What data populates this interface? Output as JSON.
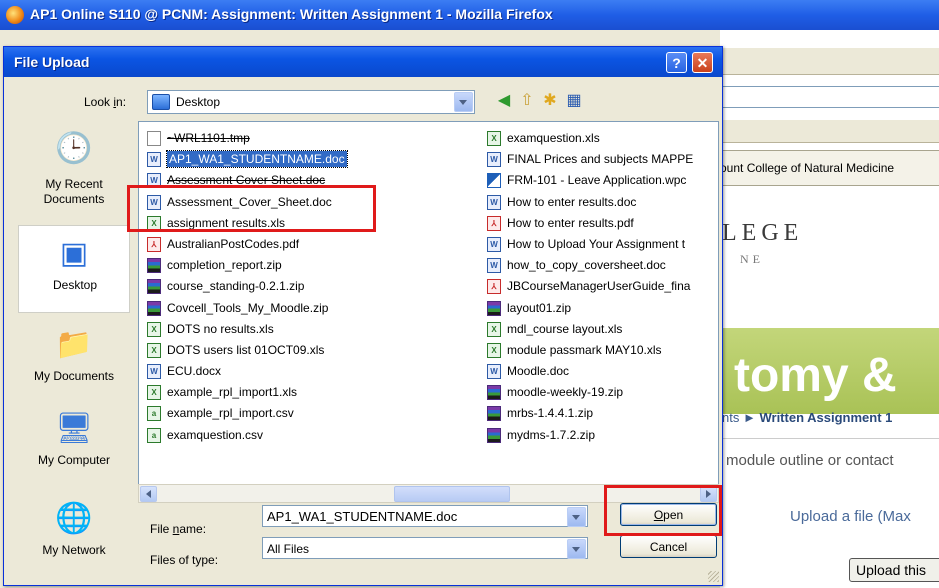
{
  "browser": {
    "title": "AP1 Online S110 @ PCNM: Assignment: Written Assignment 1 - Mozilla Firefox"
  },
  "background_page": {
    "tab_text": "ount College of Natural Medicine",
    "college_heading": "LEGE",
    "college_sub": "NE",
    "banner_text": "tomy &",
    "breadcrumb_prefix": "nts",
    "breadcrumb_sep": "►",
    "breadcrumb_current": "Written Assignment 1",
    "note": "module outline or contact",
    "upload_label": "Upload a file (Max",
    "upload_button": "Upload this"
  },
  "dialog": {
    "title": "File Upload",
    "help_label": "?",
    "close_label": "✕",
    "look_in_label": "Look in:",
    "look_in_value": "Desktop",
    "places": [
      {
        "label": "My Recent Documents",
        "icon": "recent-documents-icon"
      },
      {
        "label": "Desktop",
        "icon": "desktop-icon"
      },
      {
        "label": "My Documents",
        "icon": "my-documents-icon"
      },
      {
        "label": "My Computer",
        "icon": "my-computer-icon"
      },
      {
        "label": "My Network",
        "icon": "my-network-icon"
      }
    ],
    "files_col1": [
      {
        "name": "~WRL1101.tmp",
        "type": "tmp"
      },
      {
        "name": "AP1_WA1_STUDENTNAME.doc",
        "type": "doc"
      },
      {
        "name": "Assessment Cover Sheet.doc",
        "type": "doc"
      },
      {
        "name": "Assessment_Cover_Sheet.doc",
        "type": "doc"
      },
      {
        "name": "assignment results.xls",
        "type": "xls"
      },
      {
        "name": "AustralianPostCodes.pdf",
        "type": "pdf"
      },
      {
        "name": "completion_report.zip",
        "type": "zip"
      },
      {
        "name": "course_standing-0.2.1.zip",
        "type": "zip"
      },
      {
        "name": "Covcell_Tools_My_Moodle.zip",
        "type": "zip"
      },
      {
        "name": "DOTS no results.xls",
        "type": "xls"
      },
      {
        "name": "DOTS users list 01OCT09.xls",
        "type": "xls"
      },
      {
        "name": "ECU.docx",
        "type": "doc"
      },
      {
        "name": "example_rpl_import1.xls",
        "type": "xls"
      },
      {
        "name": "example_rpl_import.csv",
        "type": "csv"
      },
      {
        "name": "examquestion.csv",
        "type": "csv"
      }
    ],
    "files_col2": [
      {
        "name": "examquestion.xls",
        "type": "xls"
      },
      {
        "name": "FINAL Prices and subjects MAPPE",
        "type": "doc"
      },
      {
        "name": "FRM-101 - Leave Application.wpc",
        "type": "wpd"
      },
      {
        "name": "How to enter results.doc",
        "type": "doc"
      },
      {
        "name": "How to enter results.pdf",
        "type": "pdf"
      },
      {
        "name": "How to Upload Your Assignment t",
        "type": "doc"
      },
      {
        "name": "how_to_copy_coversheet.doc",
        "type": "doc"
      },
      {
        "name": "JBCourseManagerUserGuide_fina",
        "type": "pdf"
      },
      {
        "name": "layout01.zip",
        "type": "zip"
      },
      {
        "name": "mdl_course layout.xls",
        "type": "xls"
      },
      {
        "name": "module passmark MAY10.xls",
        "type": "xls"
      },
      {
        "name": "Moodle.doc",
        "type": "doc"
      },
      {
        "name": "moodle-weekly-19.zip",
        "type": "zip"
      },
      {
        "name": "mrbs-1.4.4.1.zip",
        "type": "zip"
      },
      {
        "name": "mydms-1.7.2.zip",
        "type": "zip"
      }
    ],
    "file_name_label_pre": "File ",
    "file_name_label_u": "n",
    "file_name_label_post": "ame:",
    "file_name_value": "AP1_WA1_STUDENTNAME.doc",
    "file_type_label": "Files of type:",
    "file_type_value": "All Files",
    "open_button_u": "O",
    "open_button_rest": "pen",
    "cancel_button": "Cancel"
  },
  "colors": {
    "highlight_red": "#e01a1a",
    "selection_blue": "#316ac5",
    "titlebar_blue": "#0b55e3"
  }
}
